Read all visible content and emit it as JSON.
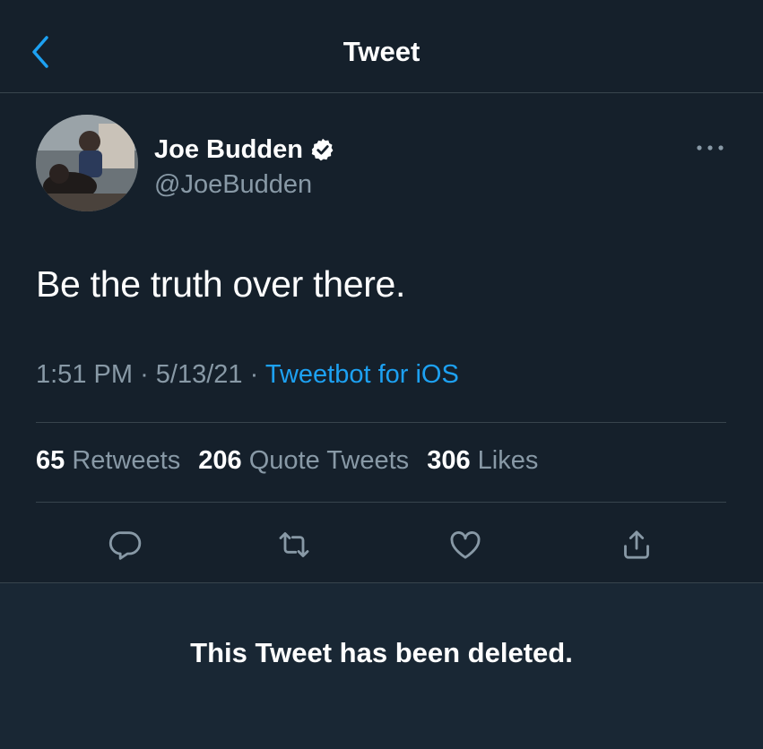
{
  "header": {
    "title": "Tweet",
    "back_icon": "chevron-left-icon"
  },
  "tweet": {
    "display_name": "Joe Budden",
    "handle": "@JoeBudden",
    "verified_icon": "verified-badge-icon",
    "text": "Be the truth over there.",
    "time": "1:51 PM",
    "date": "5/13/21",
    "separator": "·",
    "source": "Tweetbot for iOS"
  },
  "stats": {
    "retweets_count": "65",
    "retweets_label": "Retweets",
    "quotes_count": "206",
    "quotes_label": "Quote Tweets",
    "likes_count": "306",
    "likes_label": "Likes"
  },
  "actions": [
    "reply-icon",
    "retweet-icon",
    "like-icon",
    "share-icon"
  ],
  "deleted_notice": "This Tweet has been deleted.",
  "colors": {
    "background": "#15202b",
    "accent": "#1da1f2",
    "secondary_text": "#8899a6",
    "divider": "#38444d"
  }
}
